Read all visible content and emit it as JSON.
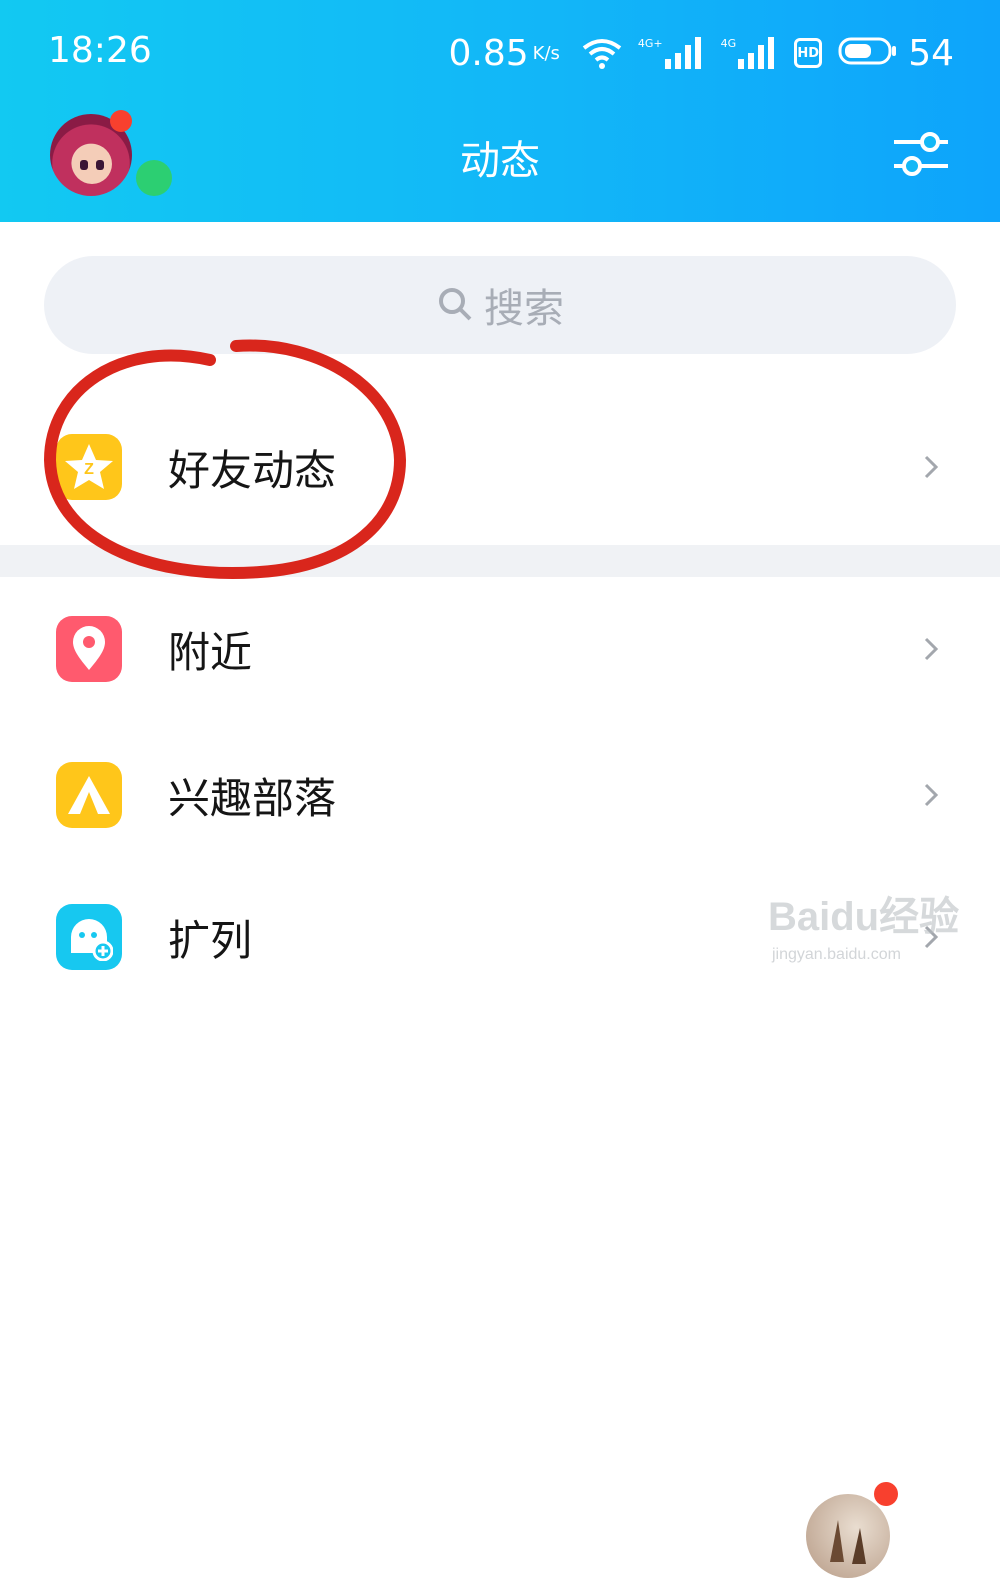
{
  "status_bar": {
    "time": "18:26",
    "speed": "0.85",
    "speed_unit": "K/s",
    "signal1_label": "4G+",
    "signal2_label": "4G",
    "hd_label": "HD",
    "battery_level": "54"
  },
  "header": {
    "title": "动态",
    "avatar_icon": "user-avatar",
    "settings_icon": "filter-sliders-icon",
    "background_colors": [
      "#12c9f2",
      "#0ea4fb"
    ]
  },
  "search": {
    "placeholder": "搜索",
    "icon": "search-icon"
  },
  "list": [
    {
      "label": "好友动态",
      "icon": "qzone-star-icon",
      "color": "#ffc61a"
    },
    {
      "label": "附近",
      "icon": "location-pin-icon",
      "color": "#ff5a6e"
    },
    {
      "label": "兴趣部落",
      "icon": "tent-icon",
      "color": "#ffc61a"
    },
    {
      "label": "扩列",
      "icon": "ghost-add-icon",
      "color": "#17c8f0"
    }
  ],
  "annotation": {
    "shape": "red hand-drawn circle around 好友动态",
    "color": "#d9261c"
  },
  "watermark": {
    "main": "Baidu经验",
    "sub": "jingyan.baidu.com"
  }
}
